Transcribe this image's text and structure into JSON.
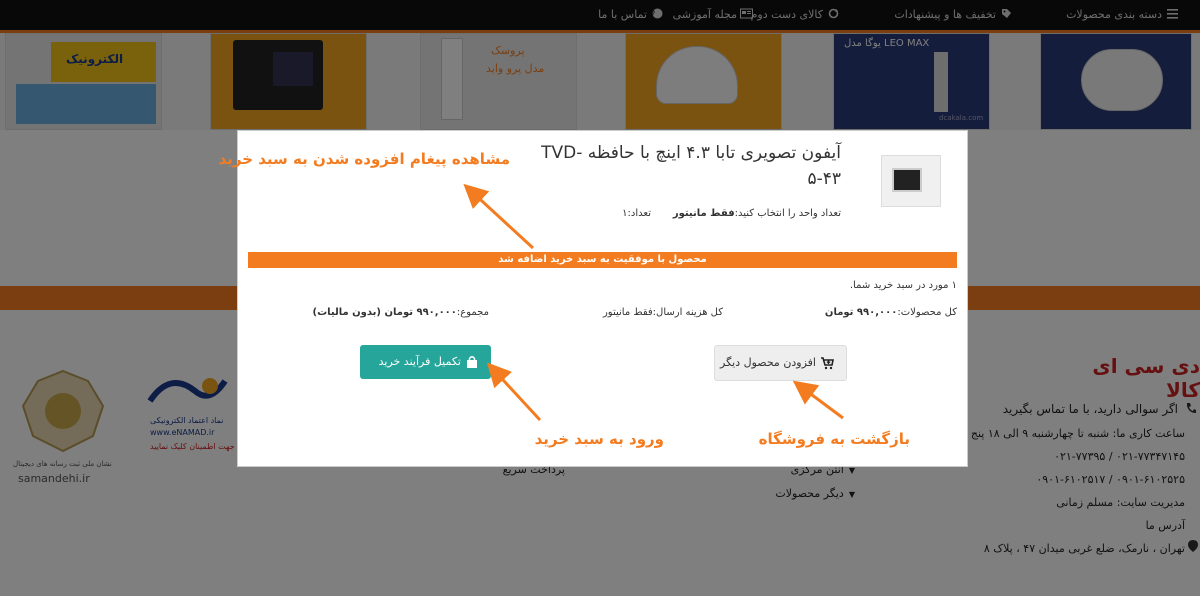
{
  "nav": {
    "categories": "دسته بندی محصولات",
    "discounts": "تخفیف ها و پیشنهادات",
    "second_hand": "کالای دست دوم",
    "magazine": "مجله آموزشی",
    "contact": "تماس با ما"
  },
  "banners": {
    "b1": "الکترونیک",
    "b2_line1": "پروسک",
    "b2_line2": "مدل پرو واید",
    "b5": "LEO MAX یوگا مدل",
    "watermark": "dcakala.com"
  },
  "footer": {
    "brand": "دی سی ای کالا",
    "q": "اگر سوالی دارید، با ما تماس بگیرید",
    "hours": "ساعت کاری ما: شنبه تا چهارشنبه ۹ الی ۱۸ پنج ش",
    "phone1": "۰۲۱-۷۷۳۴۷۱۴۵ / ۰۲۱-۷۷۳۹۵",
    "phone2": "۰۹۰۱-۶۱۰۲۵۲۵ / ۰۹۰۱-۶۱۰۲۵۱۷",
    "manager": "مدیریت سایت: مسلم زمانی",
    "address_label": "آدرس ما",
    "address": "تهران ، نارمک، ضلع غربی میدان ۴۷ ، پلاک ۸",
    "link_antenna": "آنتن مرکزی",
    "link_other": "دیگر محصولات",
    "link_quickpay": "پرداخت سریع",
    "enamad_title": "نماد اعتماد الکترونیکی",
    "enamad_url": "www.eNAMAD.ir",
    "enamad_sub": "جهت اطمینان کلیک نمایید",
    "samandehi_caption": "نشان ملی ثبت رسانه های دیجیتال",
    "samandehi_url": "samandehi.ir"
  },
  "modal": {
    "product_title_1": "آیفون تصویری تابا ۴.۳ اینچ با حافظه -TVD",
    "product_title_2": "۵-۴۳",
    "select_qty": "تعداد واحد را انتخاب کنید:",
    "select_value": "فقط مانیتور",
    "qty": "تعداد:۱",
    "success": "محصول با موفقیت به سبد خرید اضافه شد",
    "cart_count": "۱ مورد در سبد خرید شما.",
    "total_products_label": "کل محصولات:",
    "total_products_value": "۹۹۰,۰۰۰ تومان",
    "shipping": "کل هزینه ارسال:فقط مانیتور",
    "sum_label": "مجموع:",
    "sum_value": "۹۹۰,۰۰۰ تومان (بدون مالیات)",
    "add_more": "افزودن محصول دیگر",
    "checkout": "تکمیل فرآیند خرید"
  },
  "annotations": {
    "message": "مشاهده پیغام افزوده شدن به سبد خرید",
    "go_cart": "ورود به سبد خرید",
    "back_shop": "بازگشت به فروشگاه"
  },
  "colors": {
    "accent": "#f47c20",
    "checkout": "#26a69a",
    "nav_bg": "#111111"
  }
}
